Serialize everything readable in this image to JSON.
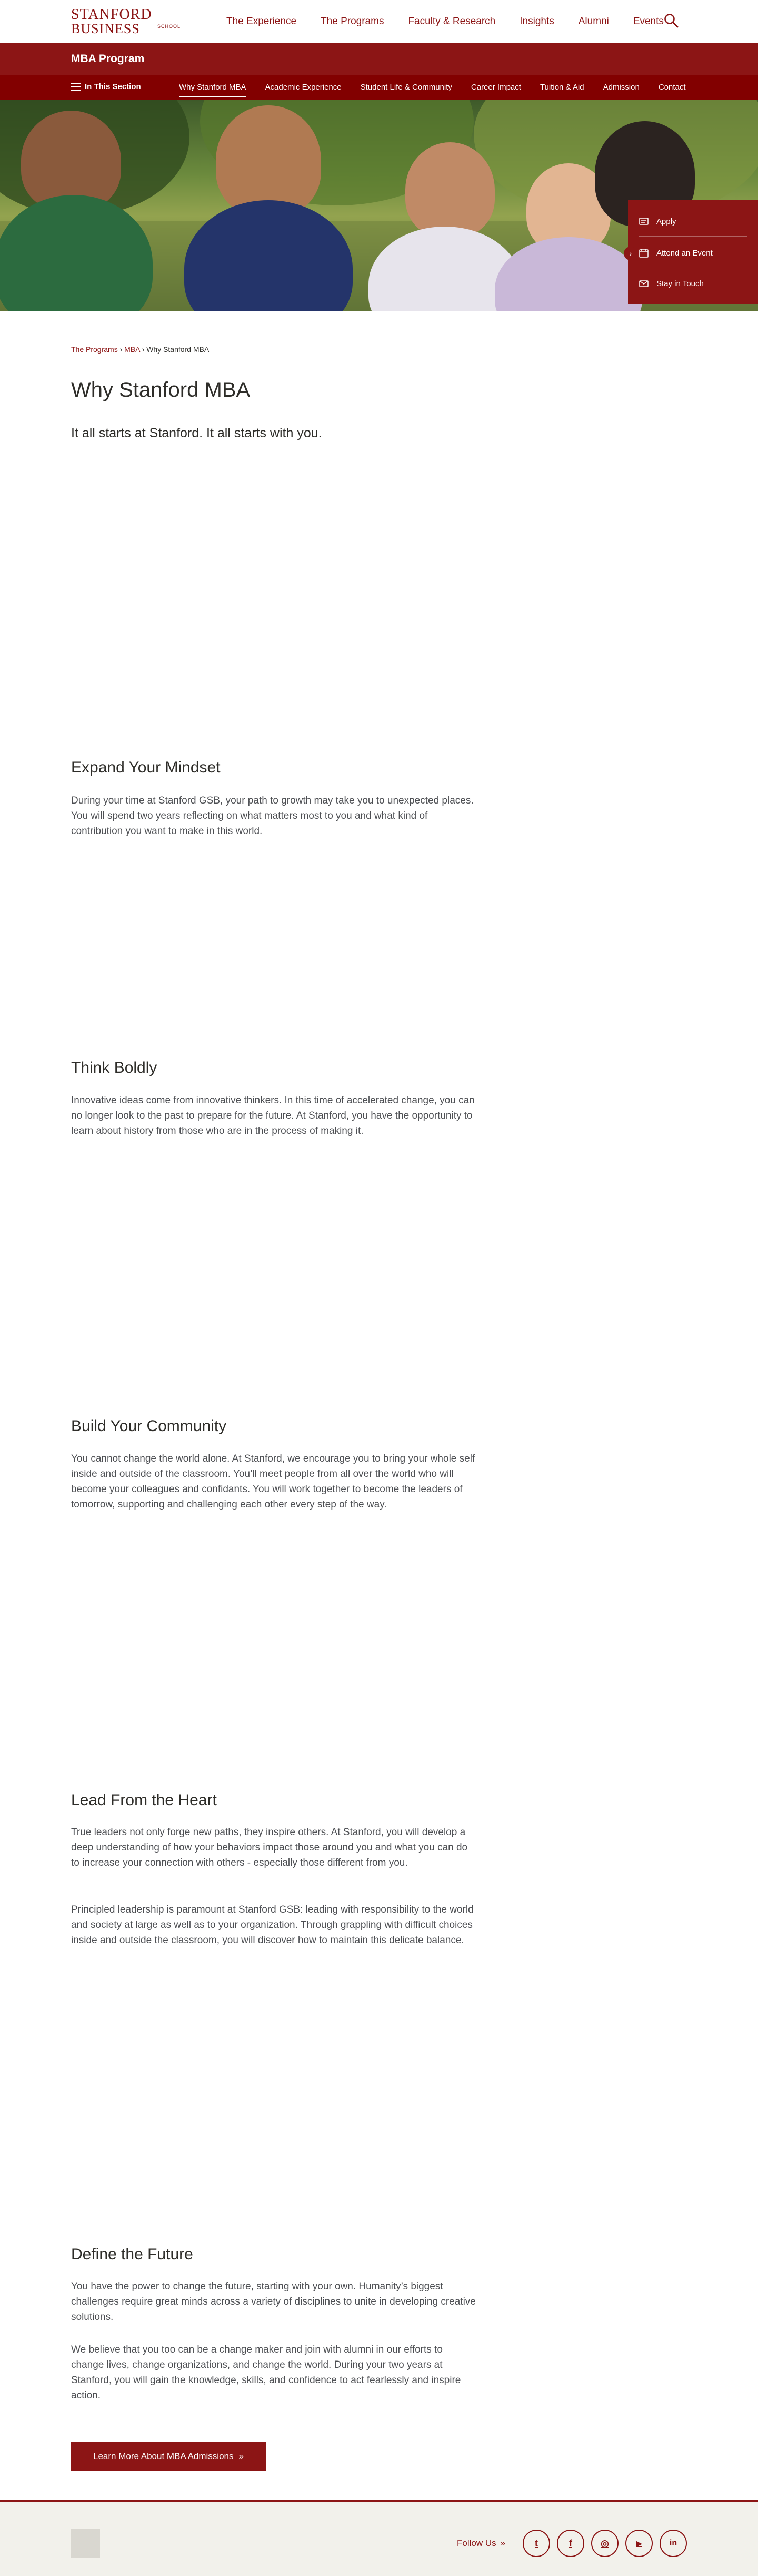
{
  "header": {
    "logo_main": "STANFORD",
    "logo_sub": "BUSINESS",
    "logo_small": "SCHOOL",
    "nav": [
      "The Experience",
      "The Programs",
      "Faculty & Research",
      "Insights",
      "Alumni",
      "Events"
    ]
  },
  "program_bar": {
    "title": "MBA Program"
  },
  "section_bar": {
    "label": "In This Section",
    "items": [
      "Why Stanford MBA",
      "Academic Experience",
      "Student Life & Community",
      "Career Impact",
      "Tuition & Aid",
      "Admission",
      "Contact"
    ]
  },
  "sidebox": {
    "items": [
      "Apply",
      "Attend an Event",
      "Stay in Touch"
    ],
    "arrow": "›"
  },
  "breadcrumb": {
    "items": [
      "The Programs",
      "MBA",
      "Why Stanford MBA"
    ],
    "separator": "›"
  },
  "page": {
    "title": "Why Stanford MBA",
    "intro": "It all starts at Stanford. It all starts with you."
  },
  "sections": [
    {
      "heading": "Expand Your Mindset",
      "paragraphs": [
        "During your time at Stanford GSB, your path to growth may take you to unexpected places. You will spend two years reflecting on what matters most to you and what kind of contribution you want to make in this world."
      ]
    },
    {
      "heading": "Think Boldly",
      "paragraphs": [
        "Innovative ideas come from innovative thinkers. In this time of accelerated change, you can no longer look to the past to prepare for the future. At Stanford, you have the opportunity to learn about history from those who are in the process of making it."
      ]
    },
    {
      "heading": "Build Your Community",
      "paragraphs": [
        "You cannot change the world alone. At Stanford, we encourage you to bring your whole self inside and outside of the classroom. You’ll meet people from all over the world who will become your colleagues and confidants. You will work together to become the leaders of tomorrow, supporting and challenging each other every step of the way."
      ]
    },
    {
      "heading": "Lead From the Heart",
      "paragraphs": [
        "True leaders not only forge new paths, they inspire others. At Stanford, you will develop a deep understanding of how your behaviors impact those around you and what you can do to increase your connection with others - especially those different from you.",
        "Principled leadership is paramount at Stanford GSB: leading with responsibility to the world and society at large as well as to your organization. Through grappling with difficult choices inside and outside the classroom, you will discover how to maintain this delicate balance."
      ]
    },
    {
      "heading": "Define the Future",
      "paragraphs": [
        "You have the power to change the future, starting with your own. Humanity’s biggest challenges require great minds across a variety of disciplines to unite in developing creative solutions.",
        "We believe that you too can be a change maker and join with alumni in our efforts to change lives, change organizations, and change the world. During your two years at Stanford, you will gain the knowledge, skills, and confidence to act fearlessly and inspire action."
      ]
    }
  ],
  "cta": {
    "label": "Learn More About MBA Admissions",
    "arrow": "»"
  },
  "footer": {
    "follow_label": "Follow Us",
    "follow_arrow": "»",
    "social": [
      {
        "icon": "twitter-icon",
        "glyph": "t"
      },
      {
        "icon": "facebook-icon",
        "glyph": "f"
      },
      {
        "icon": "instagram-icon",
        "glyph": "◎"
      },
      {
        "icon": "youtube-icon",
        "glyph": "▶"
      },
      {
        "icon": "linkedin-icon",
        "glyph": "in"
      }
    ]
  },
  "colors": {
    "cardinal": "#8c1515",
    "dark_cardinal": "#820000",
    "text": "#2e2d29",
    "footer_bg": "#f2f1eb"
  }
}
